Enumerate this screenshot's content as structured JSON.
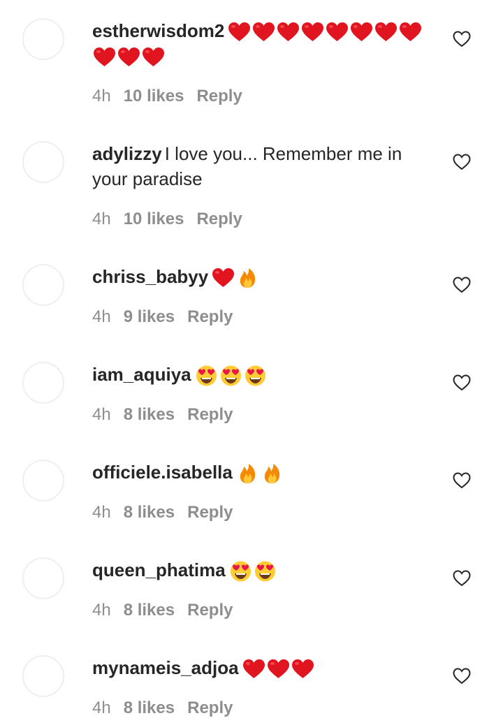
{
  "comments": [
    {
      "username": "estherwisdom2",
      "text": "",
      "emojis": [
        "red-heart",
        "red-heart",
        "red-heart",
        "red-heart",
        "red-heart",
        "red-heart",
        "red-heart",
        "red-heart",
        "red-heart",
        "red-heart",
        "red-heart"
      ],
      "time": "4h",
      "likes": "10 likes",
      "reply": "Reply"
    },
    {
      "username": "adylizzy",
      "text": "I love you... Remember me in your paradise",
      "emojis": [],
      "time": "4h",
      "likes": "10 likes",
      "reply": "Reply"
    },
    {
      "username": "chriss_babyy",
      "text": "",
      "emojis": [
        "red-heart",
        "fire"
      ],
      "time": "4h",
      "likes": "9 likes",
      "reply": "Reply"
    },
    {
      "username": "iam_aquiya",
      "text": "",
      "emojis": [
        "heart-eyes",
        "heart-eyes",
        "heart-eyes"
      ],
      "time": "4h",
      "likes": "8 likes",
      "reply": "Reply"
    },
    {
      "username": "officiele.isabella",
      "text": "",
      "emojis": [
        "fire",
        "fire"
      ],
      "time": "4h",
      "likes": "8 likes",
      "reply": "Reply"
    },
    {
      "username": "queen_phatima",
      "text": "",
      "emojis": [
        "heart-eyes",
        "heart-eyes"
      ],
      "time": "4h",
      "likes": "8 likes",
      "reply": "Reply"
    },
    {
      "username": "mynameis_adjoa",
      "text": "",
      "emojis": [
        "red-heart",
        "red-heart",
        "red-heart"
      ],
      "time": "4h",
      "likes": "8 likes",
      "reply": "Reply"
    }
  ],
  "icons": {
    "like": "heart-outline-icon"
  },
  "colors": {
    "text": "#262626",
    "meta": "#8e8e8e",
    "avatar_border": "#efefef",
    "emoji_heart": "#e0151f"
  }
}
